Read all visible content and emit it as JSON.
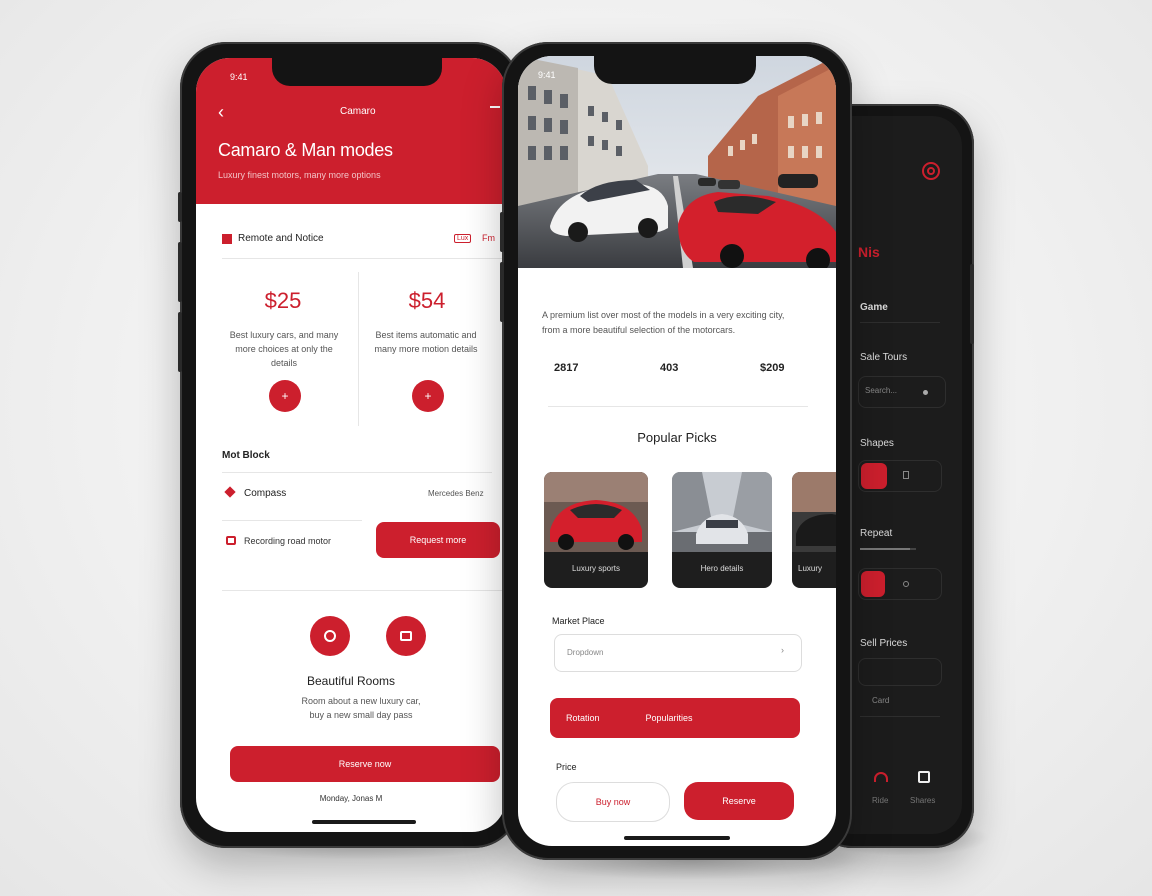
{
  "left_phone": {
    "status_time": "9:41",
    "header_title": "Camaro",
    "headline": "Camaro & Man modes",
    "subline": "Luxury finest motors, many more options",
    "section_label": "Remote and Notice",
    "section_tag": "Lux",
    "section_menu": "Fm",
    "stat_1_value": "$25",
    "stat_1_desc": "Best luxury cars, and many more choices at only the details",
    "stat_2_value": "$54",
    "stat_2_desc": "Best items automatic and many more motion details",
    "list_title": "Mot Block",
    "list_item_1": "Compass",
    "list_item_1_meta": "Mercedes Benz",
    "list_item_2": "Recording road motor",
    "list_item_2_button": "Request more",
    "bottom_title": "Beautiful Rooms",
    "bottom_desc": "Room about a new luxury car, buy a new small day pass",
    "cta_label": "Reserve now",
    "footer_text": "Monday, Jonas M"
  },
  "middle_phone": {
    "status_time": "9:41",
    "intro_text": "A premium list over most of the models in a very exciting city, from a more beautiful selection of the motorcars.",
    "stat_1": "2817",
    "stat_2": "403",
    "stat_3": "$209",
    "section_title": "Popular Picks",
    "cards": [
      {
        "label": "Luxury sports"
      },
      {
        "label": "Hero details"
      },
      {
        "label": "Luxury"
      }
    ],
    "field_label": "Market Place",
    "field_value": "Dropdown",
    "action_left": "Rotation",
    "action_right": "Popularities",
    "options_label": "Price",
    "outline_button": "Buy now",
    "solid_button": "Reserve"
  },
  "right_phone": {
    "tag_title": "Nis",
    "label_1": "Game",
    "label_2": "Sale Tours",
    "field_1_value": "Search...",
    "label_3": "Shapes",
    "label_4": "Repeat",
    "label_5": "Sell Prices",
    "field_2_value": "Card",
    "tab_1": "Ride",
    "tab_2": "Shares"
  },
  "colors": {
    "accent": "#cc1f2d",
    "dark_bg": "#1c1c1c",
    "light_bg": "#ffffff"
  }
}
